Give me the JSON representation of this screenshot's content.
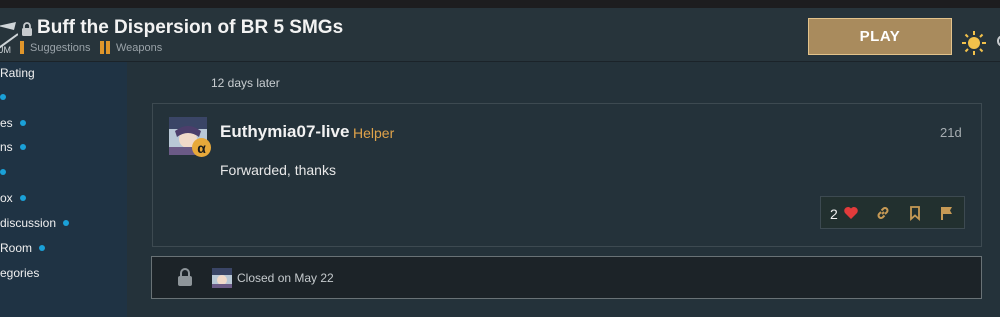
{
  "header": {
    "title": "Buff the Dispersion of BR 5 SMGs",
    "breadcrumbs": [
      {
        "label": "Suggestions"
      },
      {
        "label": "Weapons"
      }
    ],
    "play_label": "PLAY",
    "logo_text": "UM"
  },
  "sidebar": {
    "items": [
      {
        "label": "Rating",
        "dot": false
      },
      {
        "label": "",
        "dot": true
      },
      {
        "label": "es",
        "dot": true
      },
      {
        "label": "ns",
        "dot": true
      },
      {
        "label": "",
        "dot": true
      },
      {
        "label": "ox",
        "dot": true
      },
      {
        "label": "discussion",
        "dot": true
      },
      {
        "label": "Room",
        "dot": true
      },
      {
        "label": "egories",
        "dot": false
      }
    ]
  },
  "timeline": {
    "gap_label": "12 days later"
  },
  "post": {
    "username": "Euthymia07-live",
    "user_title": "Helper",
    "badge": "α",
    "date": "21d",
    "body": "Forwarded, thanks",
    "likes": "2"
  },
  "closed": {
    "text": "Closed on May 22"
  },
  "colors": {
    "accent_orange": "#e0962b",
    "play_bg": "#a98b5d",
    "helper_title": "#e0a34a",
    "sidebar_dot": "#1aa1d8",
    "like_heart": "#e23b3b"
  },
  "icons": {
    "header": [
      "lock-icon",
      "sun-icon"
    ],
    "actions": [
      "heart-icon",
      "link-icon",
      "bookmark-icon",
      "flag-icon"
    ],
    "closed": "lock-icon"
  }
}
